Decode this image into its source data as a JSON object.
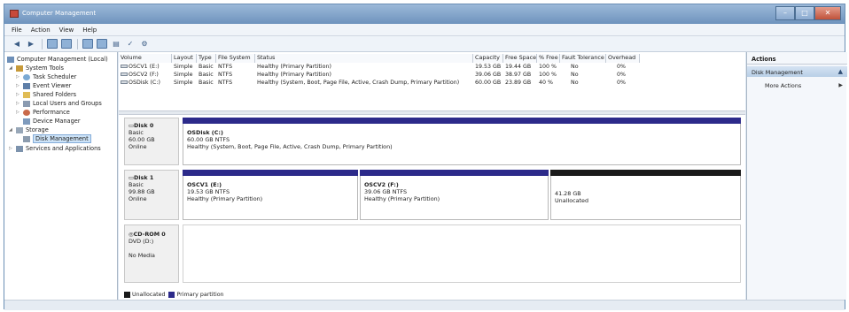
{
  "window": {
    "title": "Computer Management"
  },
  "colors": {
    "primary_partition": "#2c2a8a",
    "unallocated": "#1a1a1a"
  },
  "menu": [
    "File",
    "Action",
    "View",
    "Help"
  ],
  "tree": {
    "root": "Computer Management (Local)",
    "system_tools": "System Tools",
    "task_scheduler": "Task Scheduler",
    "event_viewer": "Event Viewer",
    "shared_folders": "Shared Folders",
    "local_users": "Local Users and Groups",
    "performance": "Performance",
    "device_manager": "Device Manager",
    "storage": "Storage",
    "disk_management": "Disk Management",
    "services": "Services and Applications"
  },
  "volume_table": {
    "headers": [
      "Volume",
      "Layout",
      "Type",
      "File System",
      "Status",
      "Capacity",
      "Free Space",
      "% Free",
      "Fault Tolerance",
      "Overhead"
    ],
    "rows": [
      [
        "OSCV1 (E:)",
        "Simple",
        "Basic",
        "NTFS",
        "Healthy (Primary Partition)",
        "19.53 GB",
        "19.44 GB",
        "100 %",
        "No",
        "0%"
      ],
      [
        "OSCV2 (F:)",
        "Simple",
        "Basic",
        "NTFS",
        "Healthy (Primary Partition)",
        "39.06 GB",
        "38.97 GB",
        "100 %",
        "No",
        "0%"
      ],
      [
        "OSDisk (C:)",
        "Simple",
        "Basic",
        "NTFS",
        "Healthy (System, Boot, Page File, Active, Crash Dump, Primary Partition)",
        "60.00 GB",
        "23.89 GB",
        "40 %",
        "No",
        "0%"
      ]
    ]
  },
  "disks": {
    "disk0": {
      "name": "Disk 0",
      "type": "Basic",
      "size": "60.00 GB",
      "state": "Online",
      "p1": {
        "name": "OSDisk (C:)",
        "size": "60.00 GB NTFS",
        "status": "Healthy (System, Boot, Page File, Active, Crash Dump, Primary Partition)"
      }
    },
    "disk1": {
      "name": "Disk 1",
      "type": "Basic",
      "size": "99.88 GB",
      "state": "Online",
      "p1": {
        "name": "OSCV1 (E:)",
        "size": "19.53 GB NTFS",
        "status": "Healthy (Primary Partition)"
      },
      "p2": {
        "name": "OSCV2 (F:)",
        "size": "39.06 GB NTFS",
        "status": "Healthy (Primary Partition)"
      },
      "p3": {
        "size": "41.28 GB",
        "status": "Unallocated"
      }
    },
    "cdrom0": {
      "name": "CD-ROM 0",
      "type": "DVD (D:)",
      "state": "No Media"
    }
  },
  "legend": {
    "unallocated": "Unallocated",
    "primary": "Primary partition"
  },
  "actions": {
    "title": "Actions",
    "section": "Disk Management",
    "more": "More Actions"
  }
}
